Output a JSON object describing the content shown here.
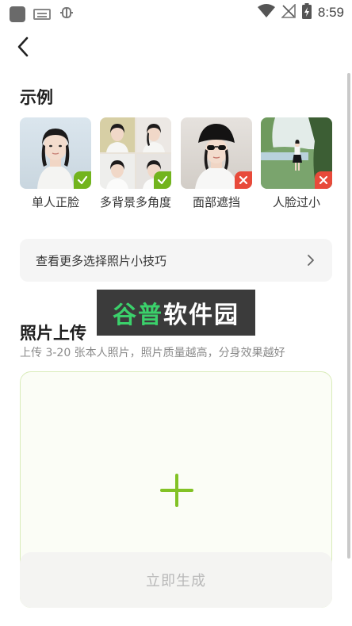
{
  "status_bar": {
    "time": "8:59",
    "left_icons": [
      "app-square-icon",
      "keyboard-icon",
      "bug-icon"
    ],
    "right_icons": [
      "wifi-icon",
      "no-signal-icon",
      "battery-charging-icon"
    ]
  },
  "header": {
    "back_icon": "chevron-left-icon"
  },
  "examples": {
    "title": "示例",
    "items": [
      {
        "label": "单人正脸",
        "status": "ok"
      },
      {
        "label": "多背景多角度",
        "status": "ok"
      },
      {
        "label": "面部遮挡",
        "status": "bad"
      },
      {
        "label": "人脸过小",
        "status": "bad"
      }
    ]
  },
  "tips": {
    "label": "查看更多选择照片小技巧",
    "arrow_icon": "chevron-right-icon"
  },
  "watermark": {
    "text_green": "谷普",
    "text_white": "软件园"
  },
  "upload": {
    "title": "照片上传",
    "subtitle": "上传 3-20 张本人照片，照片质量越高，分身效果越好",
    "add_icon": "plus-icon"
  },
  "generate_button": {
    "label": "立即生成"
  },
  "colors": {
    "accent_green": "#82c225",
    "ok_badge": "#72b41e",
    "bad_badge": "#e84a3a"
  }
}
